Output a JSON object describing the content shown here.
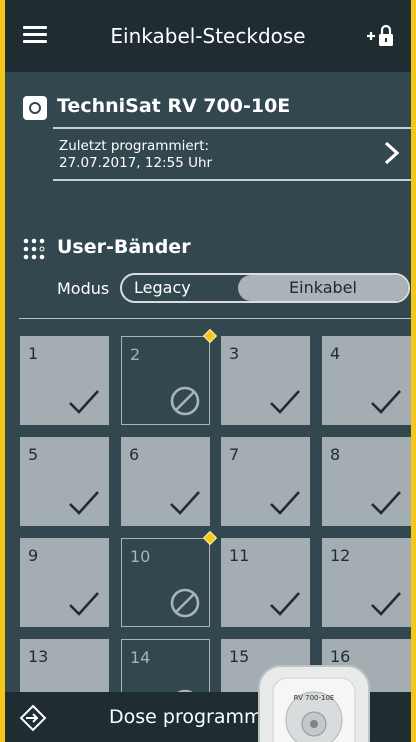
{
  "header": {
    "title": "Einkabel-Steckdose"
  },
  "device": {
    "name": "TechniSat RV 700-10E",
    "last_programmed_label": "Zuletzt programmiert:",
    "last_programmed_value": "27.07.2017, 12:55 Uhr"
  },
  "bands": {
    "title": "User-Bänder",
    "modus_label": "Modus",
    "options": [
      "Legacy",
      "Einkabel"
    ],
    "selected": "Einkabel",
    "items": [
      {
        "num": "1",
        "state": "on"
      },
      {
        "num": "2",
        "state": "off"
      },
      {
        "num": "3",
        "state": "on"
      },
      {
        "num": "4",
        "state": "on"
      },
      {
        "num": "5",
        "state": "on"
      },
      {
        "num": "6",
        "state": "on"
      },
      {
        "num": "7",
        "state": "on"
      },
      {
        "num": "8",
        "state": "on"
      },
      {
        "num": "9",
        "state": "on"
      },
      {
        "num": "10",
        "state": "off"
      },
      {
        "num": "11",
        "state": "on"
      },
      {
        "num": "12",
        "state": "on"
      },
      {
        "num": "13",
        "state": "on"
      },
      {
        "num": "14",
        "state": "off"
      },
      {
        "num": "15",
        "state": "on"
      },
      {
        "num": "16",
        "state": "on"
      }
    ],
    "flagged_after": [
      "2",
      "10"
    ]
  },
  "bottom": {
    "label": "Dose programmieren"
  },
  "photo_label": "RV 700-10E",
  "colors": {
    "accent": "#f4c81a",
    "panel": "#33474f",
    "bar": "#1f2d33",
    "cell_on": "#a4adb1"
  }
}
